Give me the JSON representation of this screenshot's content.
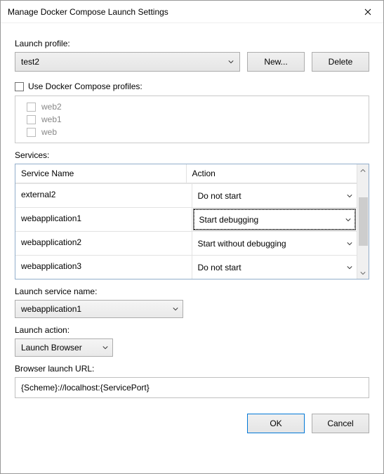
{
  "title": "Manage Docker Compose Launch Settings",
  "labels": {
    "launch_profile": "Launch profile:",
    "use_profiles": "Use Docker Compose profiles:",
    "services": "Services:",
    "service_name_header": "Service Name",
    "action_header": "Action",
    "launch_service_name": "Launch service name:",
    "launch_action": "Launch action:",
    "browser_launch_url": "Browser launch URL:"
  },
  "buttons": {
    "new": "New...",
    "delete": "Delete",
    "ok": "OK",
    "cancel": "Cancel"
  },
  "launch_profile": {
    "selected": "test2"
  },
  "use_docker_compose_profiles": {
    "checked": false,
    "items": [
      {
        "name": "web2",
        "checked": false
      },
      {
        "name": "web1",
        "checked": false
      },
      {
        "name": "web",
        "checked": false
      }
    ]
  },
  "services": [
    {
      "name": "external2",
      "action": "Do not start"
    },
    {
      "name": "webapplication1",
      "action": "Start debugging",
      "focused": true
    },
    {
      "name": "webapplication2",
      "action": "Start without debugging"
    },
    {
      "name": "webapplication3",
      "action": "Do not start"
    }
  ],
  "launch_service_name": "webapplication1",
  "launch_action": "Launch Browser",
  "browser_launch_url": "{Scheme}://localhost:{ServicePort}"
}
